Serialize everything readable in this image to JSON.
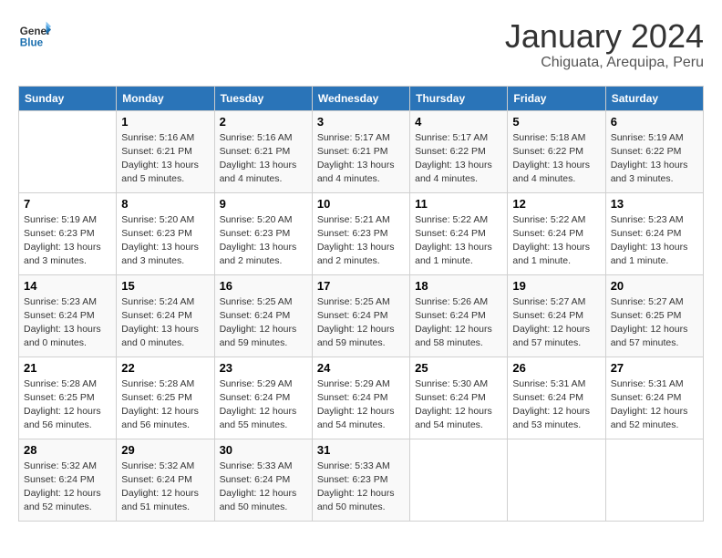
{
  "header": {
    "logo_line1": "General",
    "logo_line2": "Blue",
    "month": "January 2024",
    "location": "Chiguata, Arequipa, Peru"
  },
  "columns": [
    "Sunday",
    "Monday",
    "Tuesday",
    "Wednesday",
    "Thursday",
    "Friday",
    "Saturday"
  ],
  "weeks": [
    [
      {
        "num": "",
        "info": ""
      },
      {
        "num": "1",
        "info": "Sunrise: 5:16 AM\nSunset: 6:21 PM\nDaylight: 13 hours\nand 5 minutes."
      },
      {
        "num": "2",
        "info": "Sunrise: 5:16 AM\nSunset: 6:21 PM\nDaylight: 13 hours\nand 4 minutes."
      },
      {
        "num": "3",
        "info": "Sunrise: 5:17 AM\nSunset: 6:21 PM\nDaylight: 13 hours\nand 4 minutes."
      },
      {
        "num": "4",
        "info": "Sunrise: 5:17 AM\nSunset: 6:22 PM\nDaylight: 13 hours\nand 4 minutes."
      },
      {
        "num": "5",
        "info": "Sunrise: 5:18 AM\nSunset: 6:22 PM\nDaylight: 13 hours\nand 4 minutes."
      },
      {
        "num": "6",
        "info": "Sunrise: 5:19 AM\nSunset: 6:22 PM\nDaylight: 13 hours\nand 3 minutes."
      }
    ],
    [
      {
        "num": "7",
        "info": "Sunrise: 5:19 AM\nSunset: 6:23 PM\nDaylight: 13 hours\nand 3 minutes."
      },
      {
        "num": "8",
        "info": "Sunrise: 5:20 AM\nSunset: 6:23 PM\nDaylight: 13 hours\nand 3 minutes."
      },
      {
        "num": "9",
        "info": "Sunrise: 5:20 AM\nSunset: 6:23 PM\nDaylight: 13 hours\nand 2 minutes."
      },
      {
        "num": "10",
        "info": "Sunrise: 5:21 AM\nSunset: 6:23 PM\nDaylight: 13 hours\nand 2 minutes."
      },
      {
        "num": "11",
        "info": "Sunrise: 5:22 AM\nSunset: 6:24 PM\nDaylight: 13 hours\nand 1 minute."
      },
      {
        "num": "12",
        "info": "Sunrise: 5:22 AM\nSunset: 6:24 PM\nDaylight: 13 hours\nand 1 minute."
      },
      {
        "num": "13",
        "info": "Sunrise: 5:23 AM\nSunset: 6:24 PM\nDaylight: 13 hours\nand 1 minute."
      }
    ],
    [
      {
        "num": "14",
        "info": "Sunrise: 5:23 AM\nSunset: 6:24 PM\nDaylight: 13 hours\nand 0 minutes."
      },
      {
        "num": "15",
        "info": "Sunrise: 5:24 AM\nSunset: 6:24 PM\nDaylight: 13 hours\nand 0 minutes."
      },
      {
        "num": "16",
        "info": "Sunrise: 5:25 AM\nSunset: 6:24 PM\nDaylight: 12 hours\nand 59 minutes."
      },
      {
        "num": "17",
        "info": "Sunrise: 5:25 AM\nSunset: 6:24 PM\nDaylight: 12 hours\nand 59 minutes."
      },
      {
        "num": "18",
        "info": "Sunrise: 5:26 AM\nSunset: 6:24 PM\nDaylight: 12 hours\nand 58 minutes."
      },
      {
        "num": "19",
        "info": "Sunrise: 5:27 AM\nSunset: 6:24 PM\nDaylight: 12 hours\nand 57 minutes."
      },
      {
        "num": "20",
        "info": "Sunrise: 5:27 AM\nSunset: 6:25 PM\nDaylight: 12 hours\nand 57 minutes."
      }
    ],
    [
      {
        "num": "21",
        "info": "Sunrise: 5:28 AM\nSunset: 6:25 PM\nDaylight: 12 hours\nand 56 minutes."
      },
      {
        "num": "22",
        "info": "Sunrise: 5:28 AM\nSunset: 6:25 PM\nDaylight: 12 hours\nand 56 minutes."
      },
      {
        "num": "23",
        "info": "Sunrise: 5:29 AM\nSunset: 6:24 PM\nDaylight: 12 hours\nand 55 minutes."
      },
      {
        "num": "24",
        "info": "Sunrise: 5:29 AM\nSunset: 6:24 PM\nDaylight: 12 hours\nand 54 minutes."
      },
      {
        "num": "25",
        "info": "Sunrise: 5:30 AM\nSunset: 6:24 PM\nDaylight: 12 hours\nand 54 minutes."
      },
      {
        "num": "26",
        "info": "Sunrise: 5:31 AM\nSunset: 6:24 PM\nDaylight: 12 hours\nand 53 minutes."
      },
      {
        "num": "27",
        "info": "Sunrise: 5:31 AM\nSunset: 6:24 PM\nDaylight: 12 hours\nand 52 minutes."
      }
    ],
    [
      {
        "num": "28",
        "info": "Sunrise: 5:32 AM\nSunset: 6:24 PM\nDaylight: 12 hours\nand 52 minutes."
      },
      {
        "num": "29",
        "info": "Sunrise: 5:32 AM\nSunset: 6:24 PM\nDaylight: 12 hours\nand 51 minutes."
      },
      {
        "num": "30",
        "info": "Sunrise: 5:33 AM\nSunset: 6:24 PM\nDaylight: 12 hours\nand 50 minutes."
      },
      {
        "num": "31",
        "info": "Sunrise: 5:33 AM\nSunset: 6:23 PM\nDaylight: 12 hours\nand 50 minutes."
      },
      {
        "num": "",
        "info": ""
      },
      {
        "num": "",
        "info": ""
      },
      {
        "num": "",
        "info": ""
      }
    ]
  ]
}
